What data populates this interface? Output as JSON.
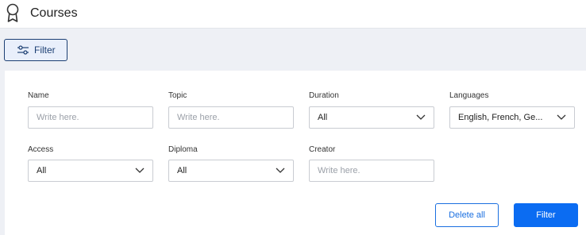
{
  "header": {
    "title": "Courses",
    "icon": "award-icon"
  },
  "filter_toggle": {
    "label": "Filter",
    "icon": "sliders-icon"
  },
  "fields": {
    "name": {
      "label": "Name",
      "placeholder": "Write here."
    },
    "topic": {
      "label": "Topic",
      "placeholder": "Write here."
    },
    "duration": {
      "label": "Duration",
      "value": "All"
    },
    "languages": {
      "label": "Languages",
      "value": "English, French, Ge..."
    },
    "access": {
      "label": "Access",
      "value": "All"
    },
    "diploma": {
      "label": "Diploma",
      "value": "All"
    },
    "creator": {
      "label": "Creator",
      "placeholder": "Write here."
    }
  },
  "actions": {
    "delete_all": "Delete all",
    "filter": "Filter"
  },
  "colors": {
    "primary": "#0b6cf2",
    "navy": "#1c3f73",
    "background": "#eef0f5"
  }
}
